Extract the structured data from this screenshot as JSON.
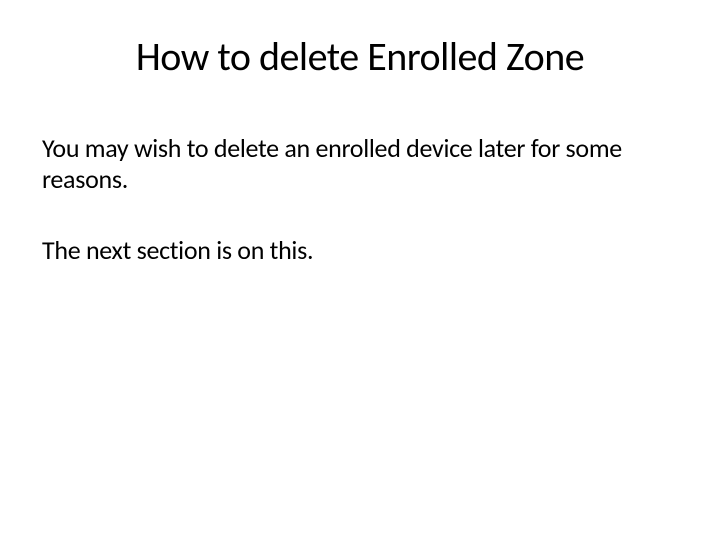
{
  "slide": {
    "title": "How to delete Enrolled Zone",
    "paragraph1": "You may wish to delete an enrolled device later for some reasons.",
    "paragraph2": "The next section is on this."
  }
}
